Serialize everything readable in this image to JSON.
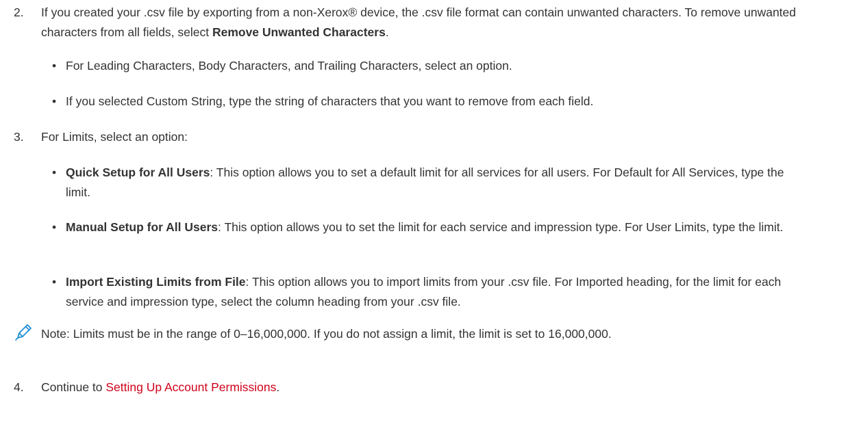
{
  "step2": {
    "number": "2.",
    "text_a": "If you created your .csv file by exporting from a non-Xerox® device, the .csv file format can contain unwanted characters. To remove unwanted characters from all fields, select ",
    "bold": "Remove Unwanted Characters",
    "text_b": ".",
    "bullets": [
      "For Leading Characters, Body Characters, and Trailing Characters, select an option.",
      "If you selected Custom String, type the string of characters that you want to remove from each field."
    ]
  },
  "step3": {
    "number": "3.",
    "text": "For Limits, select an option:",
    "bullets": [
      {
        "bold": "Quick Setup for All Users",
        "text": ": This option allows you to set a default limit for all services for all users. For Default for All Services, type the limit."
      },
      {
        "bold": "Manual Setup for All Users",
        "text": ": This option allows you to set the limit for each service and impression type. For User Limits, type the limit."
      },
      {
        "bold": "Import Existing Limits from File",
        "text": ": This option allows you to import limits from your .csv file. For Imported heading, for the limit for each service and impression type, select the column heading from your .csv file."
      }
    ]
  },
  "note": {
    "icon": "pencil-icon",
    "text": "Note: Limits must be in the range of 0–16,000,000. If you do not assign a limit, the limit is set to 16,000,000."
  },
  "step4": {
    "number": "4.",
    "text": "Continue to ",
    "link": "Setting Up Account Permissions",
    "text_b": "."
  },
  "colors": {
    "text": "#333333",
    "link": "#d0021b",
    "icon": "#1e8fd6"
  }
}
